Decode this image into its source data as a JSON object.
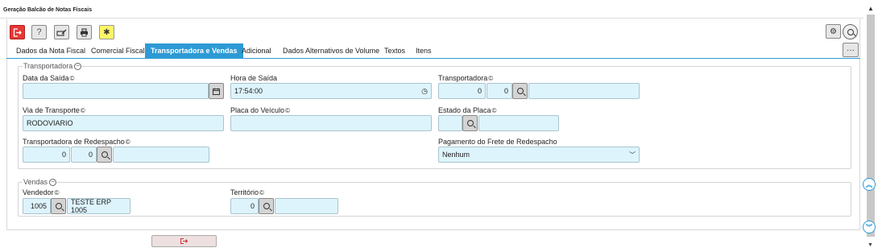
{
  "window": {
    "title": "Geração Balcão de Notas Fiscais"
  },
  "toolbar": {
    "help_label": "?"
  },
  "tabs": [
    {
      "label": "Dados da Nota Fiscal"
    },
    {
      "label": "Comercial Fiscal"
    },
    {
      "label": "Transportadora e Vendas"
    },
    {
      "label": "Adicional"
    },
    {
      "label": "Dados Alternativos de Volume"
    },
    {
      "label": "Textos"
    },
    {
      "label": "Itens"
    }
  ],
  "transportadora_group": {
    "legend": "Transportadora",
    "data_saida": {
      "label": "Data da Saída",
      "value": ""
    },
    "hora_saida": {
      "label": "Hora de Saída",
      "value": "17:54:00"
    },
    "transportadora": {
      "label": "Transportadora",
      "code1": "0",
      "code2": "0",
      "name": ""
    },
    "via_transporte": {
      "label": "Via de Transporte",
      "value": "RODOVIARIO"
    },
    "placa_veiculo": {
      "label": "Placa do Veículo",
      "value": ""
    },
    "estado_placa": {
      "label": "Estado da Placa",
      "code": "",
      "name": ""
    },
    "transp_redespacho": {
      "label": "Transportadora de Redespacho",
      "code1": "0",
      "code2": "0",
      "name": ""
    },
    "pagamento_frete": {
      "label": "Pagamento do Frete de Redespacho",
      "value": "Nenhum"
    }
  },
  "vendas_group": {
    "legend": "Vendas",
    "vendedor": {
      "label": "Vendedor",
      "code": "1005",
      "name": "TESTE ERP 1005"
    },
    "territorio": {
      "label": "Território",
      "code": "0",
      "name": ""
    }
  }
}
